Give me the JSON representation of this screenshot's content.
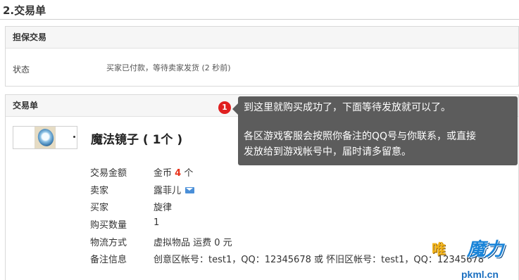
{
  "page": {
    "title": "2.交易单"
  },
  "escrow": {
    "header": "担保交易",
    "status_label": "状态",
    "status_value": "买家已付款，等待卖家发货 (2 秒前)"
  },
  "order": {
    "header": "交易单",
    "item_name": "魔法镜子 ( 1个 )",
    "rows": {
      "amount": {
        "label": "交易金额",
        "prefix": "金币 ",
        "value": "4",
        "suffix": " 个"
      },
      "seller": {
        "label": "卖家",
        "value": "露菲儿"
      },
      "buyer": {
        "label": "买家",
        "value": "旋律"
      },
      "quantity": {
        "label": "购买数量",
        "value": "1"
      },
      "shipping": {
        "label": "物流方式",
        "value": "虚拟物品 运费 0 元"
      },
      "note": {
        "label": "备注信息",
        "value": "创意区帐号：test1，QQ：12345678 或 怀旧区帐号：test1，QQ：12345678"
      }
    }
  },
  "tooltip": {
    "badge": "1",
    "line1": "到这里就购买成功了，下面等待发放就可以了。",
    "line2": "各区游戏客服会按照你备注的QQ号与你联系，或直接",
    "line3": "发放给到游戏帐号中，届时请多留意。"
  },
  "watermark": {
    "logo_text1": "唯",
    "logo_text2": "魔力",
    "url": "pkml.cn"
  },
  "colors": {
    "accent_red": "#e8321a",
    "badge_red": "#e02020",
    "tooltip_bg": "#5c5c5c",
    "mail_blue": "#4a8fd8"
  },
  "icons": {
    "seller_contact": "mail-icon",
    "item_thumbnail": "magic-mirror-icon"
  }
}
